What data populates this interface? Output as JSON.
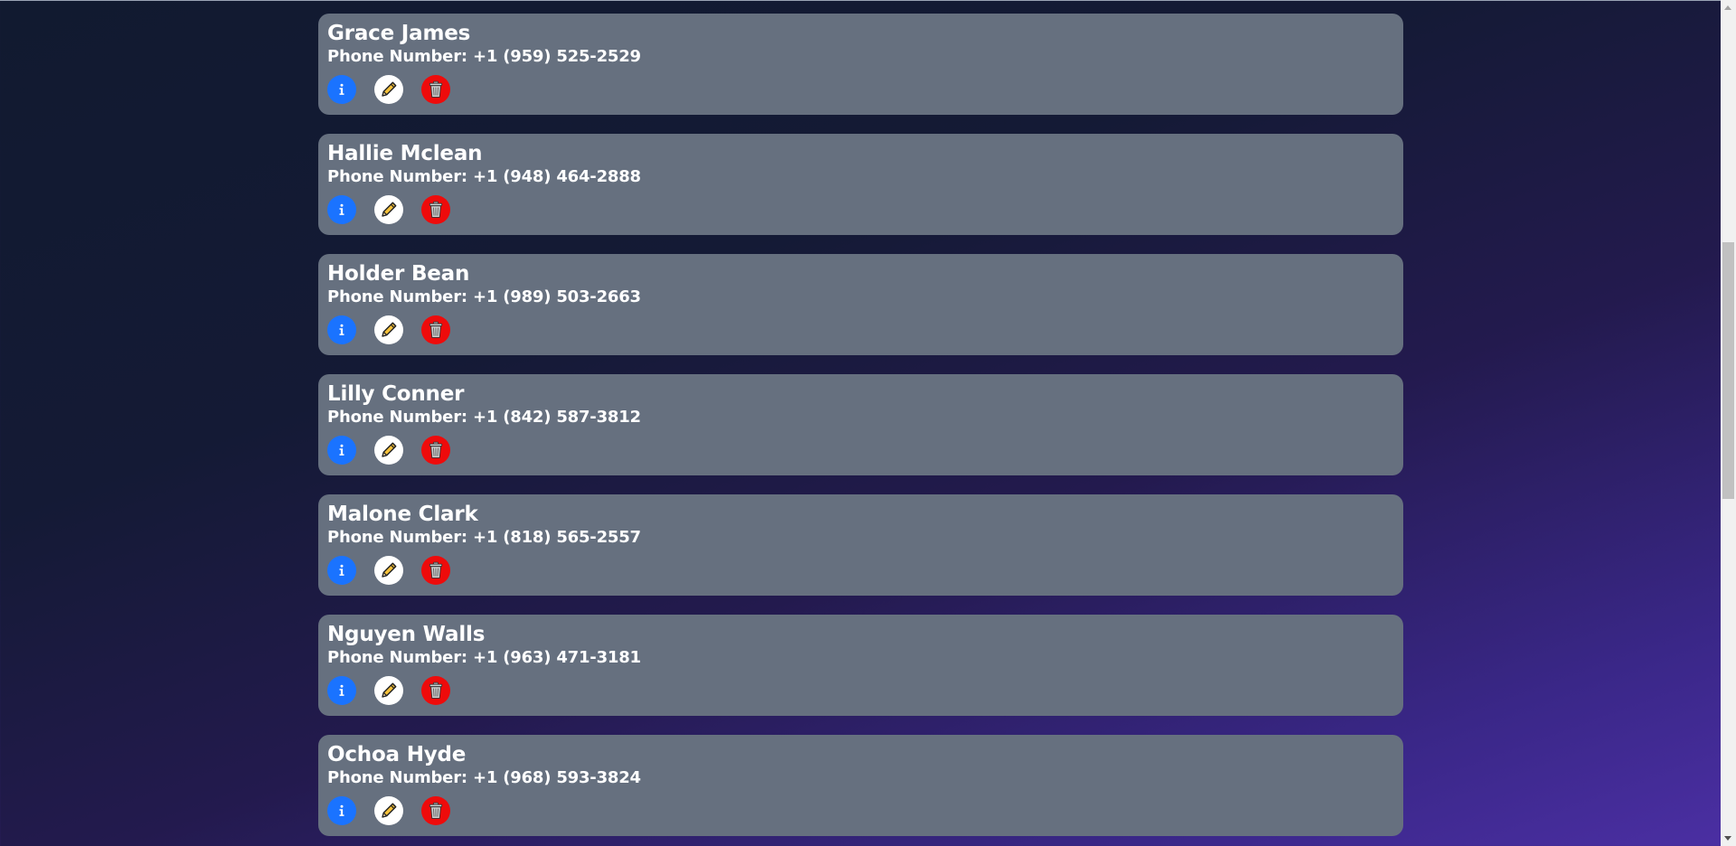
{
  "phone_prefix": "Phone Number:",
  "contacts": [
    {
      "name": "Grace James",
      "phone": "+1 (959) 525-2529"
    },
    {
      "name": "Hallie Mclean",
      "phone": "+1 (948) 464-2888"
    },
    {
      "name": "Holder Bean",
      "phone": "+1 (989) 503-2663"
    },
    {
      "name": "Lilly Conner",
      "phone": "+1 (842) 587-3812"
    },
    {
      "name": "Malone Clark",
      "phone": "+1 (818) 565-2557"
    },
    {
      "name": "Nguyen Walls",
      "phone": "+1 (963) 471-3181"
    },
    {
      "name": "Ochoa Hyde",
      "phone": "+1 (968) 593-3824"
    }
  ],
  "icons": {
    "info": "info-icon",
    "edit": "pencil-icon",
    "delete": "trash-icon"
  },
  "colors": {
    "card_bg": "#66707f",
    "info_button": "#1a73ff",
    "edit_button": "#ffffff",
    "delete_button": "#ee0b0b"
  }
}
